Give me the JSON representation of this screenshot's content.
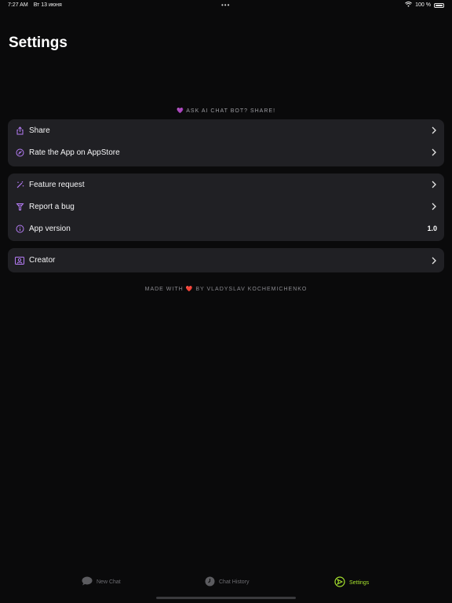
{
  "status_bar": {
    "time": "7:27 AM",
    "date": "Вт 13 июня",
    "center_dots": "•••",
    "battery_percent": "100 %"
  },
  "page": {
    "title": "Settings"
  },
  "promo": {
    "heart": "💜",
    "text": "ASK AI CHAT BOT? SHARE!"
  },
  "groups": {
    "share_group": {
      "share_label": "Share",
      "rate_label": "Rate the App on AppStore"
    },
    "info_group": {
      "feature_label": "Feature request",
      "bug_label": "Report a bug",
      "version_label": "App version",
      "version_value": "1.0"
    },
    "creator_group": {
      "creator_label": "Creator"
    }
  },
  "footer": {
    "prefix": "MADE WITH",
    "heart": "❤️",
    "suffix": "BY VLADYSLAV KOCHEMICHENKO"
  },
  "tabbar": {
    "tabs": [
      {
        "label": "New Chat",
        "icon": "chat-bubble-icon",
        "active": false
      },
      {
        "label": "Chat History",
        "icon": "clock-icon",
        "active": false
      },
      {
        "label": "Settings",
        "icon": "settings-icon",
        "active": true
      }
    ]
  },
  "colors": {
    "accent": "#a6e22e",
    "icon_purple": "#b57cf6",
    "background": "#0a0a0b",
    "card": "#202024"
  }
}
